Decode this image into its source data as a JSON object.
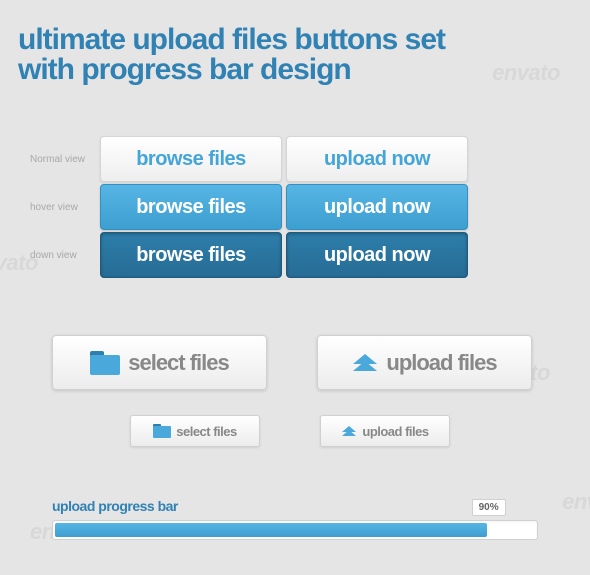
{
  "title_line1": "ultimate upload files buttons set",
  "title_line2": "with progress bar design",
  "watermark": "envato",
  "states": {
    "normal": {
      "label": "Normal view",
      "browse": "browse files",
      "upload": "upload now"
    },
    "hover": {
      "label": "hover view",
      "browse": "browse files",
      "upload": "upload now"
    },
    "down": {
      "label": "down view",
      "browse": "browse files",
      "upload": "upload now"
    }
  },
  "icon_buttons": {
    "select": "select files",
    "upload": "upload files"
  },
  "small_buttons": {
    "select": "select files",
    "upload": "upload files"
  },
  "progress": {
    "label": "upload progress bar",
    "percent": 90,
    "percent_text": "90%"
  }
}
